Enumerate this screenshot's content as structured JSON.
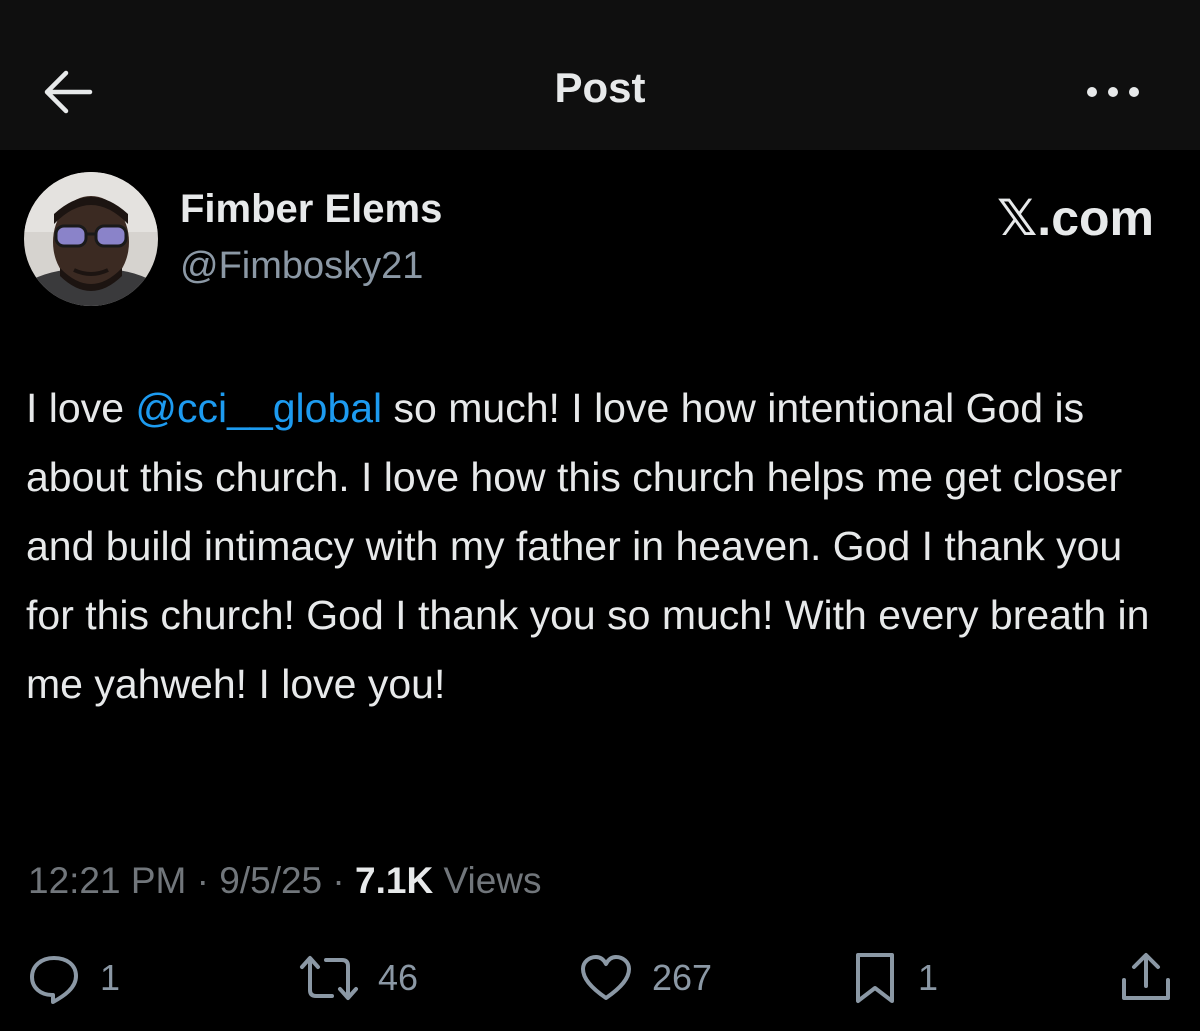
{
  "header": {
    "title": "Post",
    "back_icon": "arrow-left-icon",
    "more_icon": "more-horizontal-icon"
  },
  "post": {
    "author": {
      "display_name": "Fimber Elems",
      "handle": "@Fimbosky21"
    },
    "brand": "𝕏.com",
    "text": {
      "before_mention": "I love ",
      "mention": "@cci__global",
      "after_mention": " so much! I love how intentional God is about this church. I love how this church helps me get closer and build intimacy with my father in heaven. God I thank you for this church! God I thank you so much! With every breath in me yahweh! I love you!"
    },
    "meta": {
      "time": "12:21 PM",
      "separator": " · ",
      "date": "9/5/25",
      "views_count": "7.1K",
      "views_label": " Views"
    },
    "actions": {
      "reply": {
        "icon": "reply-icon",
        "count": "1"
      },
      "repost": {
        "icon": "repost-icon",
        "count": "46"
      },
      "like": {
        "icon": "heart-icon",
        "count": "267"
      },
      "bookmark": {
        "icon": "bookmark-icon",
        "count": "1"
      },
      "share": {
        "icon": "share-icon"
      }
    }
  },
  "colors": {
    "background": "#000000",
    "topbar": "#0f0f0f",
    "text_primary": "#e7e9ea",
    "text_secondary": "#71767b",
    "link": "#1d9bf0"
  }
}
